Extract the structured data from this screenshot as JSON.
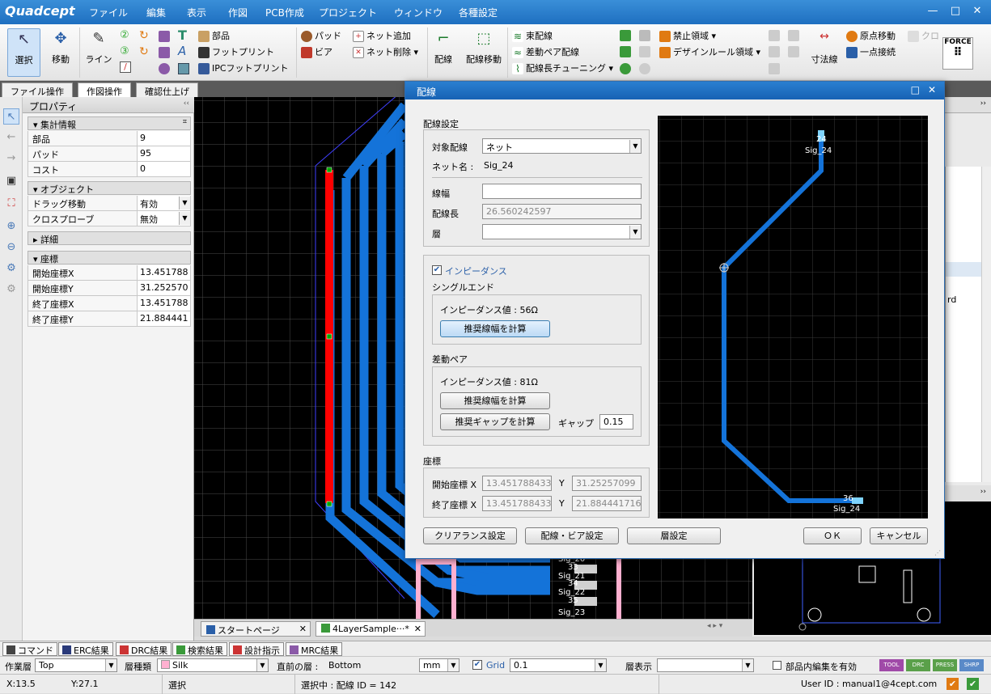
{
  "app": {
    "name": "Quadcept"
  },
  "menu": [
    "ファイル",
    "編集",
    "表示",
    "作図",
    "PCB作成",
    "プロジェクト",
    "ウィンドウ",
    "各種設定"
  ],
  "ribbon": {
    "select": "選択",
    "move": "移動",
    "line": "ライン",
    "part": "部品",
    "footprint": "フットプリント",
    "ipc_footprint": "IPCフットプリント",
    "pad": "パッド",
    "via": "ビア",
    "net_add": "ネット追加",
    "net_delete": "ネット削除",
    "route": "配線",
    "route_move": "配線移動",
    "bundle_route": "束配線",
    "diff_pair_route": "差動ペア配線",
    "length_tuning": "配線長チューニング",
    "keepout": "禁止領域",
    "design_rule_area": "デザインルール領域",
    "dimension": "寸法線",
    "origin_move": "原点移動",
    "single_point": "一点接続",
    "clip": "クロ",
    "force": "FORCE"
  },
  "func_tabs": [
    "ファイル操作",
    "作図操作",
    "確認仕上げ"
  ],
  "properties": {
    "title": "プロパティ",
    "sections": {
      "summary": "集計情報",
      "object": "オブジェクト",
      "detail": "詳細",
      "coords": "座標"
    },
    "summary": [
      {
        "k": "部品",
        "v": "9"
      },
      {
        "k": "パッド",
        "v": "95"
      },
      {
        "k": "コスト",
        "v": "0"
      }
    ],
    "object": [
      {
        "k": "ドラッグ移動",
        "v": "有効"
      },
      {
        "k": "クロスプローブ",
        "v": "無効"
      }
    ],
    "coords": [
      {
        "k": "開始座標X",
        "v": "13.451788"
      },
      {
        "k": "開始座標Y",
        "v": "31.252570"
      },
      {
        "k": "終了座標X",
        "v": "13.451788"
      },
      {
        "k": "終了座標Y",
        "v": "21.884441"
      }
    ]
  },
  "canvas_labels": [
    "Sig_20",
    "33",
    "Sig_21",
    "34",
    "Sig_22",
    "35",
    "Sig_23"
  ],
  "doc_tabs": [
    "スタートページ",
    "4LayerSample···*"
  ],
  "right_panel_partial": "rd",
  "bottom_tabs": [
    "コマンド",
    "ERC結果",
    "DRC結果",
    "検索結果",
    "設計指示",
    "MRC結果"
  ],
  "layerbar": {
    "work_layer_label": "作業層",
    "work_layer": "Top",
    "layer_type_label": "層種類",
    "layer_type": "Silk",
    "prev_layer_label": "直前の層 :",
    "prev_layer": "Bottom",
    "unit": "mm",
    "grid_label": "Grid",
    "grid": "0.1",
    "layer_display_label": "層表示",
    "layer_display": "",
    "in_part_edit": "部品内編集を有効",
    "badges": [
      "TOOL",
      "DRC",
      "PRESS",
      "SHRP"
    ]
  },
  "status": {
    "x": "X:13.5",
    "y": "Y:27.1",
    "mode": "選択",
    "selection": "選択中 : 配線 ID = 142",
    "user": "User ID : manual1@4cept.com"
  },
  "dialog": {
    "title": "配線",
    "route_settings": "配線設定",
    "target_label": "対象配線",
    "target": "ネット",
    "net_name_label": "ネット名 :",
    "net_name": "Sig_24",
    "width_label": "線幅",
    "width": "",
    "length_label": "配線長",
    "length": "26.560242597",
    "layer_label": "層",
    "layer": "",
    "impedance": "インピーダンス",
    "single_end": "シングルエンド",
    "single_imp": "インピーダンス値 : 56Ω",
    "calc_width": "推奨線幅を計算",
    "diff_pair": "差動ペア",
    "diff_imp": "インピーダンス値 : 81Ω",
    "calc_width2": "推奨線幅を計算",
    "calc_gap": "推奨ギャップを計算",
    "gap_label": "ギャップ",
    "gap": "0.15",
    "coords": "座標",
    "start_label": "開始座標 X",
    "start_x": "13.451788433",
    "start_y": "31.25257099",
    "end_label": "終了座標 X",
    "end_x": "13.451788433",
    "end_y": "21.884441716",
    "y_label": "Y",
    "btn_clearance": "クリアランス設定",
    "btn_route_via": "配線・ビア設定",
    "btn_layer": "層設定",
    "btn_ok": "ＯＫ",
    "btn_cancel": "キャンセル",
    "preview": {
      "top_pin": "24",
      "top_net": "Sig_24",
      "bottom_pin": "36",
      "bottom_net": "Sig_24"
    }
  },
  "colors": {
    "title_blue": "#1e6fc0",
    "trace_blue": "#1473d9",
    "trace_red": "#ff0000",
    "pad_pink": "#ffb0d0"
  }
}
